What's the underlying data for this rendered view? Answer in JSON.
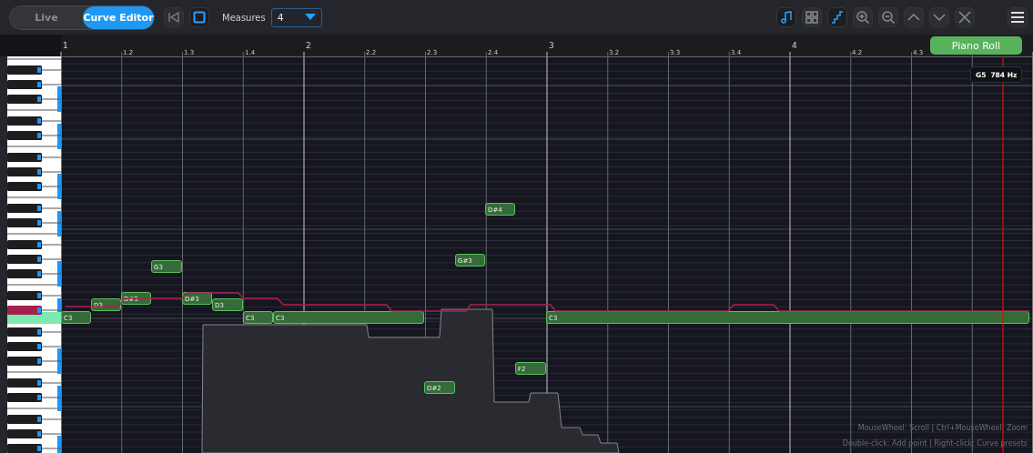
{
  "toolbar": {
    "mode_tabs": [
      {
        "label": "Live",
        "selected": false
      },
      {
        "label": "Curve Editor",
        "selected": true
      }
    ],
    "transport": [
      {
        "kind": "rewind",
        "on": false
      },
      {
        "kind": "stop",
        "on": true
      }
    ],
    "measures": {
      "label": "Measures",
      "value": "4"
    },
    "tools": [
      {
        "kind": "note",
        "on": true
      },
      {
        "kind": "grid",
        "on": false
      },
      {
        "kind": "steps",
        "on": true
      },
      {
        "kind": "zoom-in",
        "on": false
      },
      {
        "kind": "zoom-out",
        "on": false
      },
      {
        "kind": "up",
        "on": false
      },
      {
        "kind": "down",
        "on": false
      },
      {
        "kind": "close",
        "on": false
      }
    ],
    "menu": {
      "kind": "menu"
    }
  },
  "ruler": [
    {
      "label": "1",
      "kind": "measure"
    },
    {
      "label": "1.2",
      "kind": "beat"
    },
    {
      "label": "1.3",
      "kind": "beat"
    },
    {
      "label": "1.4",
      "kind": "beat"
    },
    {
      "label": "2",
      "kind": "measure"
    },
    {
      "label": "2.2",
      "kind": "beat"
    },
    {
      "label": "2.3",
      "kind": "beat"
    },
    {
      "label": "2.4",
      "kind": "beat"
    },
    {
      "label": "3",
      "kind": "measure"
    },
    {
      "label": "3.2",
      "kind": "beat"
    },
    {
      "label": "3.3",
      "kind": "beat"
    },
    {
      "label": "3.4",
      "kind": "beat"
    },
    {
      "label": "4",
      "kind": "measure"
    },
    {
      "label": "4.2",
      "kind": "beat"
    },
    {
      "label": "4.3",
      "kind": "beat"
    }
  ],
  "piano_roll_button": "Piano Roll",
  "cursor_tooltip": {
    "note": "G5",
    "frequency": "784 Hz"
  },
  "notes": [
    {
      "label": "C3"
    },
    {
      "label": "D3"
    },
    {
      "label": "D#3"
    },
    {
      "label": "G3"
    },
    {
      "label": "D#3"
    },
    {
      "label": "D3"
    },
    {
      "label": "C3"
    },
    {
      "label": "C3"
    },
    {
      "label": "D#2"
    },
    {
      "label": "G#3"
    },
    {
      "label": "D#4"
    },
    {
      "label": "F2"
    },
    {
      "label": "C3"
    }
  ],
  "hints": [
    "MouseWheel: Scroll | Ctrl+MouseWheel: Zoom",
    "Double-click: Add point | Right-click: Curve presets"
  ]
}
